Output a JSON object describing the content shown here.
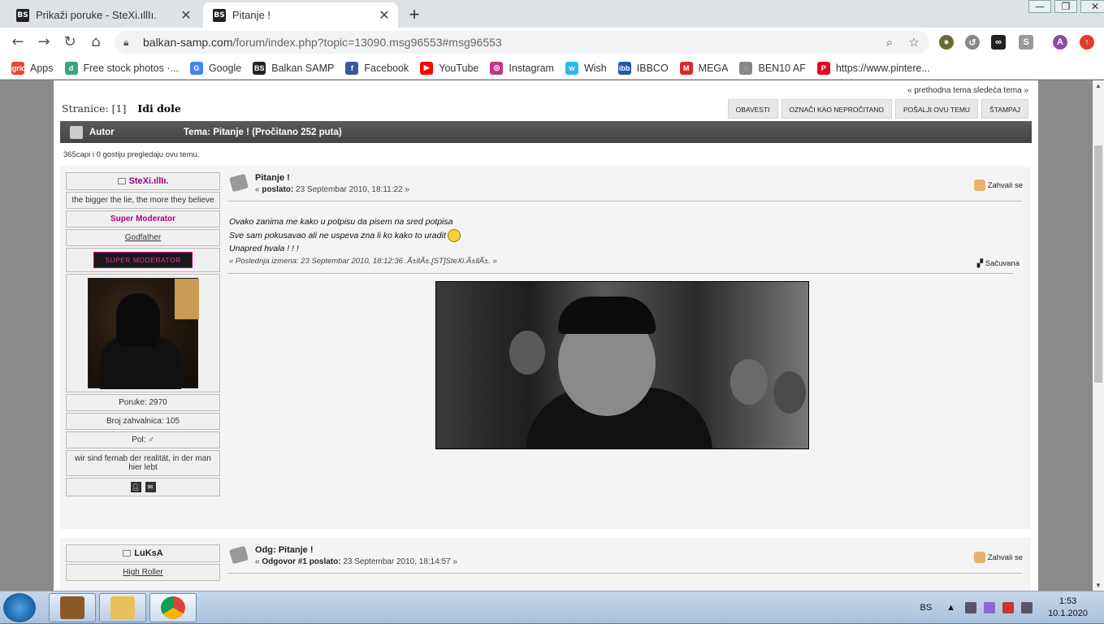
{
  "browser": {
    "tabs": [
      {
        "title": "Prikaži poruke - SteXi.ıllIı.",
        "favicon": "BS"
      },
      {
        "title": "Pitanje !",
        "favicon": "BS"
      }
    ],
    "new_tab": "+",
    "url_host": "balkan-samp.com",
    "url_path": "/forum/index.php?topic=13090.msg96553#msg96553",
    "profile_letter": "A",
    "bookmarks": [
      {
        "label": "Apps",
        "icon": "apps-grid-icon",
        "color": "#e94335"
      },
      {
        "label": "Free stock photos ·...",
        "icon": "d",
        "color": "#3aa57a"
      },
      {
        "label": "Google",
        "icon": "G",
        "color": "#4285f4"
      },
      {
        "label": "Balkan SAMP",
        "icon": "BS",
        "color": "#222222"
      },
      {
        "label": "Facebook",
        "icon": "f",
        "color": "#3b5998"
      },
      {
        "label": "YouTube",
        "icon": "▶",
        "color": "#ff0000"
      },
      {
        "label": "Instagram",
        "icon": "◎",
        "color": "#c13584"
      },
      {
        "label": "Wish",
        "icon": "w",
        "color": "#2fb7ec"
      },
      {
        "label": "IBBCO",
        "icon": "ibb",
        "color": "#1e5aa8"
      },
      {
        "label": "MEGA",
        "icon": "M",
        "color": "#d9272e"
      },
      {
        "label": "BEN10 AF",
        "icon": "◌",
        "color": "#888888"
      },
      {
        "label": "https://www.pintere...",
        "icon": "P",
        "color": "#e60023"
      }
    ]
  },
  "forum": {
    "topnav": "« prethodna tema sledeća tema »",
    "pages_label": "Stranice:",
    "pages_current": "[1]",
    "go_down": "Idi dole",
    "buttons": [
      "OBAVESTI",
      "OZNAČI KAO NEPROČITANO",
      "POŠALJI OVU TEMU",
      "ŠTAMPAJ"
    ],
    "header_author": "Autor",
    "header_topic": "Tema: Pitanje !  (Pročitano 252 puta)",
    "viewers": "365capi i 0 gostiju pregledaju ovu temu.",
    "posts": [
      {
        "poster_name": "SteXi.ıllIı.",
        "poster_text": "the bigger the lie, the more they believe",
        "poster_group": "Super Moderator",
        "poster_title": "Godfather",
        "poster_badge": "SUPER MODERATOR",
        "poster_posts": "Poruke: 2970",
        "poster_thanks": "Broj zahvalnica: 105",
        "poster_gender": "Pol: ♂",
        "poster_signature": "wir sind fernab der realität, in der man hier lebt",
        "title": "Pitanje !",
        "meta_prefix": "« ",
        "meta_bold": "poslato:",
        "meta_date": " 23 Septembar 2010, 18:11:22 »",
        "thanks_label": "Zahvali se",
        "body_lines": [
          "Ovako zanima me kako u potpisu da pisem na sred potpisa",
          "Sve sam pokusavao ali ne uspeva zna li ko kako to uradit",
          "Unapred hvala ! ! !"
        ],
        "edit_note": "« Poslednja izmena: 23 Septembar 2010, 18:12:36 .Ã±llÃ±.[ST]SteXi.Ã±llÃ±. »",
        "saved_label": "Sačuvana"
      },
      {
        "poster_name": "LuKsA",
        "poster_title": "High Roller",
        "title": "Odg: Pitanje !",
        "meta_prefix": "« ",
        "meta_bold": "Odgovor #1 poslato:",
        "meta_date": " 23 Septembar 2010, 18:14:57 »",
        "thanks_label": "Zahvali se"
      }
    ]
  },
  "taskbar": {
    "lang": "BS",
    "time": "1:53",
    "date": "10.1.2020"
  }
}
